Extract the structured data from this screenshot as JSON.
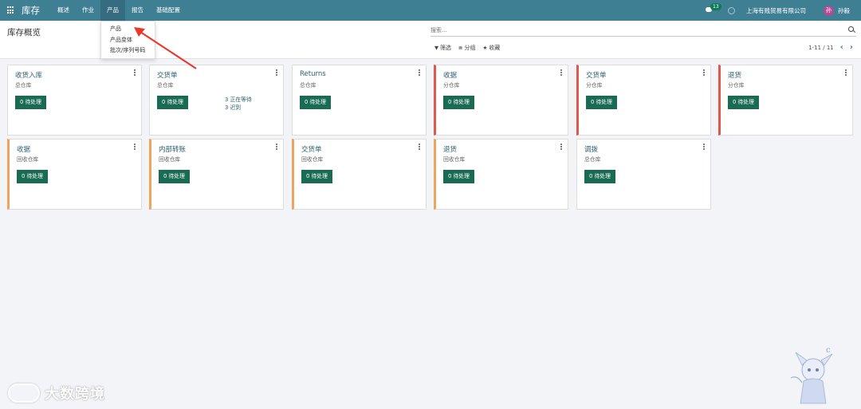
{
  "nav": {
    "app_title": "库存",
    "menu": [
      "概述",
      "作业",
      "产品",
      "报告",
      "基础配置"
    ],
    "active_index": 2,
    "chat_count": "13",
    "company": "上海有贱贸易有限公司",
    "avatar_initial": "孙",
    "user": "孙毅"
  },
  "dropdown": {
    "items": [
      "产品",
      "产品变体",
      "批次/序列号码"
    ]
  },
  "control": {
    "title": "库存概览",
    "search_placeholder": "搜索...",
    "filter_label": "筛选",
    "group_label": "分组",
    "favorite_label": "收藏",
    "pager": "1-11 / 11"
  },
  "cards": [
    {
      "title": "收货入库",
      "warehouse": "总仓库",
      "button": "0 待处理",
      "stripe": "none"
    },
    {
      "title": "交货单",
      "warehouse": "总仓库",
      "button": "0 待处理",
      "stripe": "none",
      "stat_waiting": "3 正在等待",
      "stat_late": "3 迟到"
    },
    {
      "title": "Returns",
      "warehouse": "总仓库",
      "button": "0 待处理",
      "stripe": "none"
    },
    {
      "title": "收据",
      "warehouse": "分仓库",
      "button": "0 待处理",
      "stripe": "red"
    },
    {
      "title": "交货单",
      "warehouse": "分仓库",
      "button": "0 待处理",
      "stripe": "red"
    },
    {
      "title": "退货",
      "warehouse": "分仓库",
      "button": "0 待处理",
      "stripe": "red"
    },
    {
      "title": "收据",
      "warehouse": "回收仓库",
      "button": "0 待处理",
      "stripe": "orange"
    },
    {
      "title": "内部转账",
      "warehouse": "回收仓库",
      "button": "0 待处理",
      "stripe": "orange"
    },
    {
      "title": "交货单",
      "warehouse": "回收仓库",
      "button": "0 待处理",
      "stripe": "orange"
    },
    {
      "title": "退货",
      "warehouse": "回收仓库",
      "button": "0 待处理",
      "stripe": "orange"
    },
    {
      "title": "调拨",
      "warehouse": "总仓库",
      "button": "0 待处理",
      "stripe": "none"
    }
  ],
  "watermark": {
    "text": "大数跨境"
  },
  "colors": {
    "nav_bg": "#3f7f94",
    "button_bg": "#1a6b54",
    "stripe_red": "#e0584c",
    "stripe_orange": "#f0a35c",
    "title_link": "#2a5f70"
  }
}
